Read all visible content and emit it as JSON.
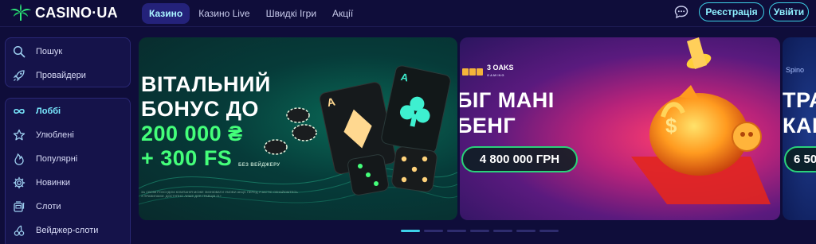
{
  "header": {
    "logo_text": "CASINO·UA",
    "nav": [
      {
        "label": "Казино",
        "active": true
      },
      {
        "label": "Казино Live",
        "active": false
      },
      {
        "label": "Швидкі Ігри",
        "active": false
      },
      {
        "label": "Акції",
        "active": false
      }
    ],
    "register_label": "Реєстрація",
    "login_label": "Увійти"
  },
  "sidebar": {
    "top_items": [
      {
        "label": "Пошук",
        "icon": "search-icon"
      },
      {
        "label": "Провайдери",
        "icon": "rocket-icon"
      }
    ],
    "items": [
      {
        "label": "Лоббі",
        "icon": "infinity-icon",
        "active": true
      },
      {
        "label": "Улюблені",
        "icon": "star-icon"
      },
      {
        "label": "Популярні",
        "icon": "fire-icon"
      },
      {
        "label": "Новинки",
        "icon": "gear-icon"
      },
      {
        "label": "Слоти",
        "icon": "slot-machine-icon"
      },
      {
        "label": "Вейджер-слоти",
        "icon": "cherry-icon"
      }
    ]
  },
  "banners": {
    "welcome": {
      "line1": "ВІТАЛЬНИЙ",
      "line2": "БОНУС ДО",
      "line3": "200 000 ₴",
      "line4": "+ 300 FS",
      "note": "БЕЗ ВЕЙДЖЕРУ",
      "fine_print": "ЗА СВОЇМ РОЗСУДОМ КОМПАНІЯ МОЖЕ ЗМІНЮВАТИ УМОВИ АКЦІЇ. ПЕРЕД УЧАСТЮ ОЗНАЙОМТЕСЬ З ПРАВИЛАМИ. ДОСТУПНО ЛИШЕ ДЛЯ ГРАВЦІВ 21+"
    },
    "big_money": {
      "provider": "3 OAKS",
      "provider_sub": "GAMING",
      "line1": "БІГ МАНІ",
      "line2": "БЕНГ",
      "prize": "4 800 000 ГРН"
    },
    "third": {
      "provider": "Spino",
      "line1": "ТРА",
      "line2": "КАН",
      "prize": "6 50"
    }
  },
  "carousel": {
    "slide_count": 7,
    "active_index": 0
  },
  "colors": {
    "background": "#0f0d3a",
    "accent": "#3dd1e8",
    "green": "#44ff7a"
  }
}
